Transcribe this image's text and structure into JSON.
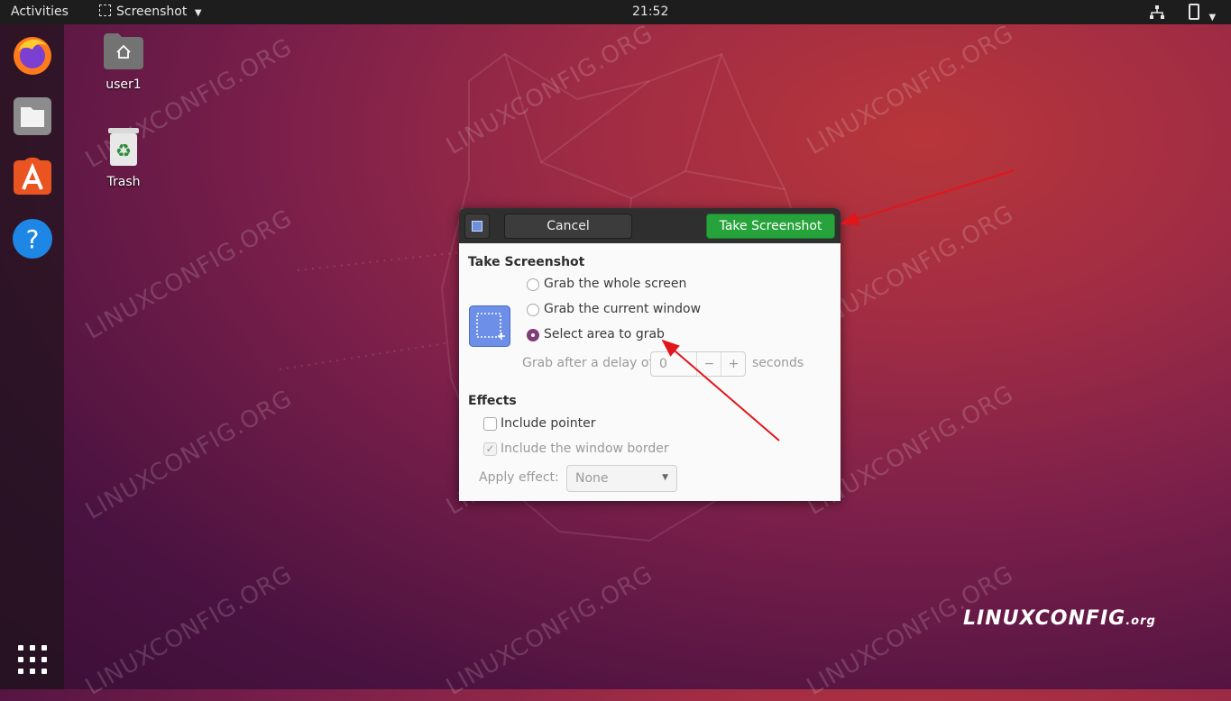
{
  "topbar": {
    "activities": "Activities",
    "app_menu": "Screenshot",
    "clock": "21:52"
  },
  "desktop": {
    "icons": [
      {
        "label": "user1",
        "icon": "home-folder-icon"
      },
      {
        "label": "Trash",
        "icon": "trash-icon"
      }
    ]
  },
  "dock": {
    "items": [
      "firefox-icon",
      "files-icon",
      "software-store-icon",
      "help-icon",
      "show-apps-icon"
    ]
  },
  "dialog": {
    "cancel_label": "Cancel",
    "take_label": "Take Screenshot",
    "section_title": "Take Screenshot",
    "options": [
      {
        "label": "Grab the whole screen",
        "selected": false
      },
      {
        "label": "Grab the current window",
        "selected": false
      },
      {
        "label": "Select area to grab",
        "selected": true
      }
    ],
    "delay_label": "Grab after a delay of",
    "delay_value": "0",
    "delay_minus": "−",
    "delay_plus": "+",
    "delay_unit": "seconds",
    "effects_title": "Effects",
    "include_pointer": {
      "label": "Include pointer",
      "checked": false
    },
    "include_border": {
      "label": "Include the window border",
      "checked": true
    },
    "apply_effect_label": "Apply effect:",
    "apply_effect_value": "None"
  },
  "watermark": {
    "text": "LINUXCONFIG.ORG",
    "brand": "LINUXCONFIG",
    "brand_suffix": ".org"
  },
  "colors": {
    "accent_green": "#26a33a",
    "radio_selected": "#7f3e79",
    "arrow_red": "#e0161b"
  }
}
